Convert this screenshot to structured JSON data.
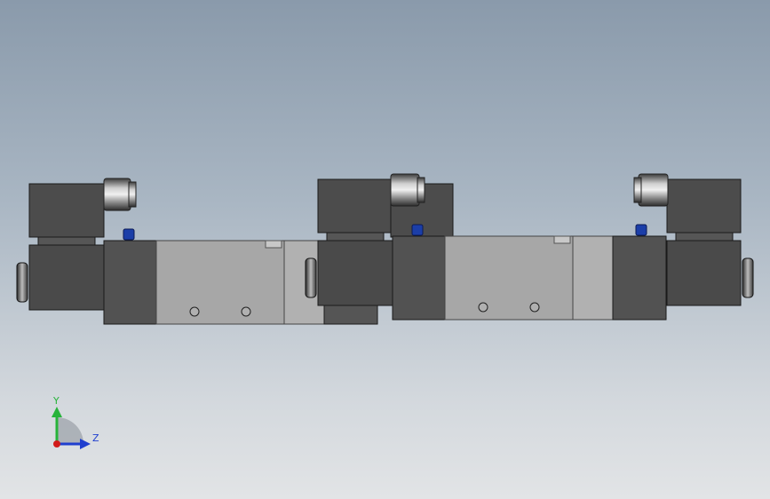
{
  "viewport": {
    "background_top": "#8a9aab",
    "background_bottom": "#e2e4e6"
  },
  "model": {
    "body_color": "#a2a2a2",
    "body_light": "#acacac",
    "dark_block_color": "#4f4f4f",
    "coil_color": "#4a4a4a",
    "connector_color": "#9a9a9a",
    "indicator_color": "#1b3ea8"
  },
  "triad": {
    "y_label": "Y",
    "z_label": "Z",
    "y_color": "#27b33a",
    "z_color": "#1f3fcf",
    "x_color": "#d11a1a"
  }
}
